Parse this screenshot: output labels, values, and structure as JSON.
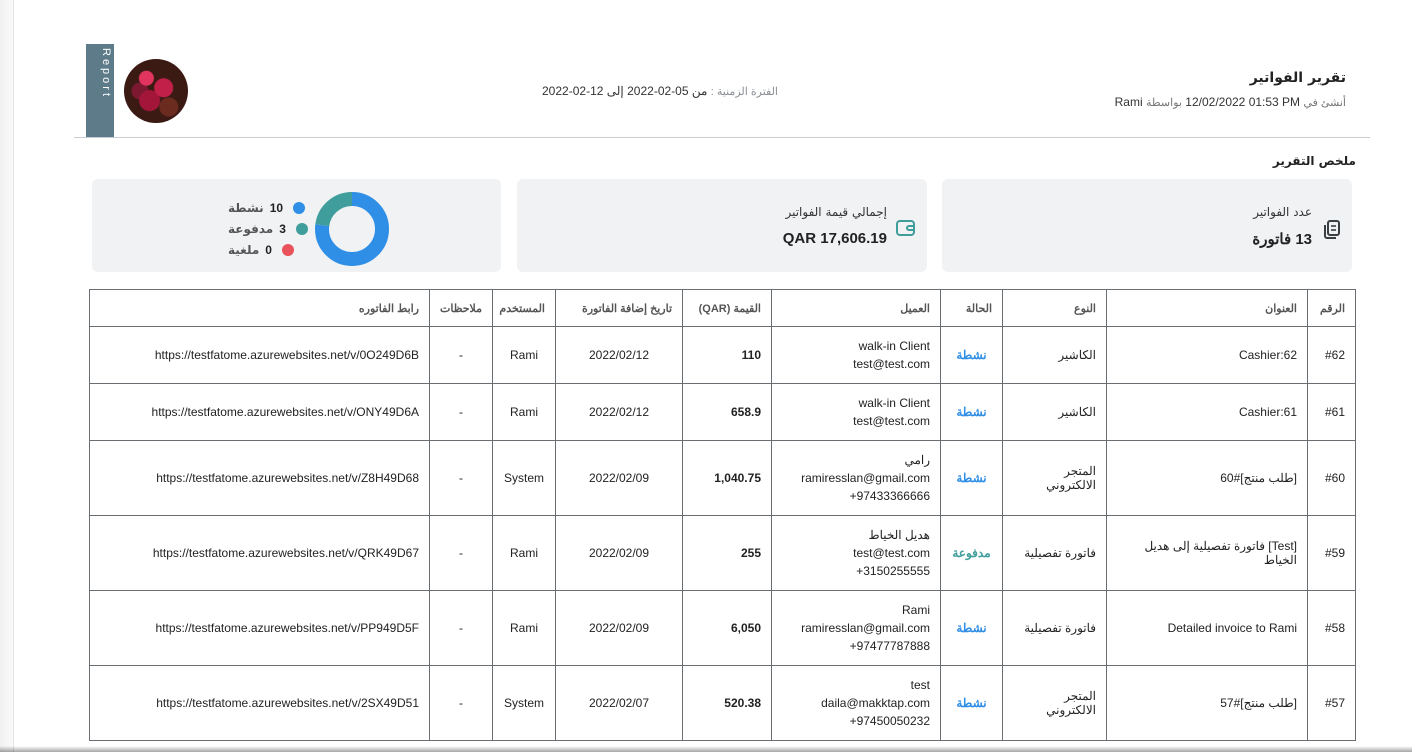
{
  "header": {
    "report_tab": "Report",
    "title": "تقرير الفواتير",
    "created_label": "أنشئ في",
    "created_value": "12/02/2022 01:53 PM",
    "created_by_label": "بواسطة",
    "created_by": "Rami",
    "period_label": "الفترة الزمنية :",
    "period_from_label": "من",
    "period_from": "05-02-2022",
    "period_to_label": "إلى",
    "period_to": "12-02-2022"
  },
  "summary": {
    "title": "ملخص التقرير",
    "count_label": "عدد الفواتير",
    "count_value": "13 فاتورة",
    "total_label": "إجمالي قيمة الفواتير",
    "total_value": "17,606.19 QAR",
    "status_legend": [
      {
        "label": "نشطة",
        "count": "10",
        "color": "#2f8fe6"
      },
      {
        "label": "مدفوعة",
        "count": "3",
        "color": "#3f9d9b"
      },
      {
        "label": "ملغية",
        "count": "0",
        "color": "#e9525a"
      }
    ],
    "donut": {
      "active": 10,
      "paid": 3,
      "cancelled": 0
    }
  },
  "table": {
    "headers": [
      "الرقم",
      "العنوان",
      "النوع",
      "الحالة",
      "العميل",
      "القيمة (QAR)",
      "تاريخ إضافة الفاتورة",
      "المستخدم",
      "ملاحظات",
      "رابط الفاتوره"
    ],
    "rows": [
      {
        "num": "#62",
        "title": "Cashier:62",
        "type": "الكاشير",
        "status": "نشطة",
        "status_color": "#2f8fe6",
        "client": [
          "walk-in Client",
          "test@test.com"
        ],
        "amount": "110",
        "date": "2022/02/12",
        "user": "Rami",
        "notes": "-",
        "link": "https://testfatome.azurewebsites.net/v/0O249D6B"
      },
      {
        "num": "#61",
        "title": "Cashier:61",
        "type": "الكاشير",
        "status": "نشطة",
        "status_color": "#2f8fe6",
        "client": [
          "walk-in Client",
          "test@test.com"
        ],
        "amount": "658.9",
        "date": "2022/02/12",
        "user": "Rami",
        "notes": "-",
        "link": "https://testfatome.azurewebsites.net/v/ONY49D6A"
      },
      {
        "num": "#60",
        "title": "[طلب منتج]#60",
        "type": "المتجر الالكتروني",
        "status": "نشطة",
        "status_color": "#2f8fe6",
        "client": [
          "رامي",
          "ramiresslan@gmail.com",
          "97433366666+"
        ],
        "amount": "1,040.75",
        "date": "2022/02/09",
        "user": "System",
        "notes": "-",
        "link": "https://testfatome.azurewebsites.net/v/Z8H49D68"
      },
      {
        "num": "#59",
        "title": "[Test] فاتورة تفصيلية إلى هديل الخياط",
        "type": "فاتورة تفصيلية",
        "status": "مدفوعة",
        "status_color": "#3f9d9b",
        "client": [
          "هديل الخياط",
          "test@test.com",
          "3150255555+"
        ],
        "amount": "255",
        "date": "2022/02/09",
        "user": "Rami",
        "notes": "-",
        "link": "https://testfatome.azurewebsites.net/v/QRK49D67"
      },
      {
        "num": "#58",
        "title": "Detailed invoice to Rami",
        "type": "فاتورة تفصيلية",
        "status": "نشطة",
        "status_color": "#2f8fe6",
        "client": [
          "Rami",
          "ramiresslan@gmail.com",
          "97477787888+"
        ],
        "amount": "6,050",
        "date": "2022/02/09",
        "user": "Rami",
        "notes": "-",
        "link": "https://testfatome.azurewebsites.net/v/PP949D5F"
      },
      {
        "num": "#57",
        "title": "[طلب منتج]#57",
        "type": "المتجر الالكتروني",
        "status": "نشطة",
        "status_color": "#2f8fe6",
        "client": [
          "test",
          "daila@makktap.com",
          "97450050232+"
        ],
        "amount": "520.38",
        "date": "2022/02/07",
        "user": "System",
        "notes": "-",
        "link": "https://testfatome.azurewebsites.net/v/2SX49D51"
      }
    ]
  }
}
